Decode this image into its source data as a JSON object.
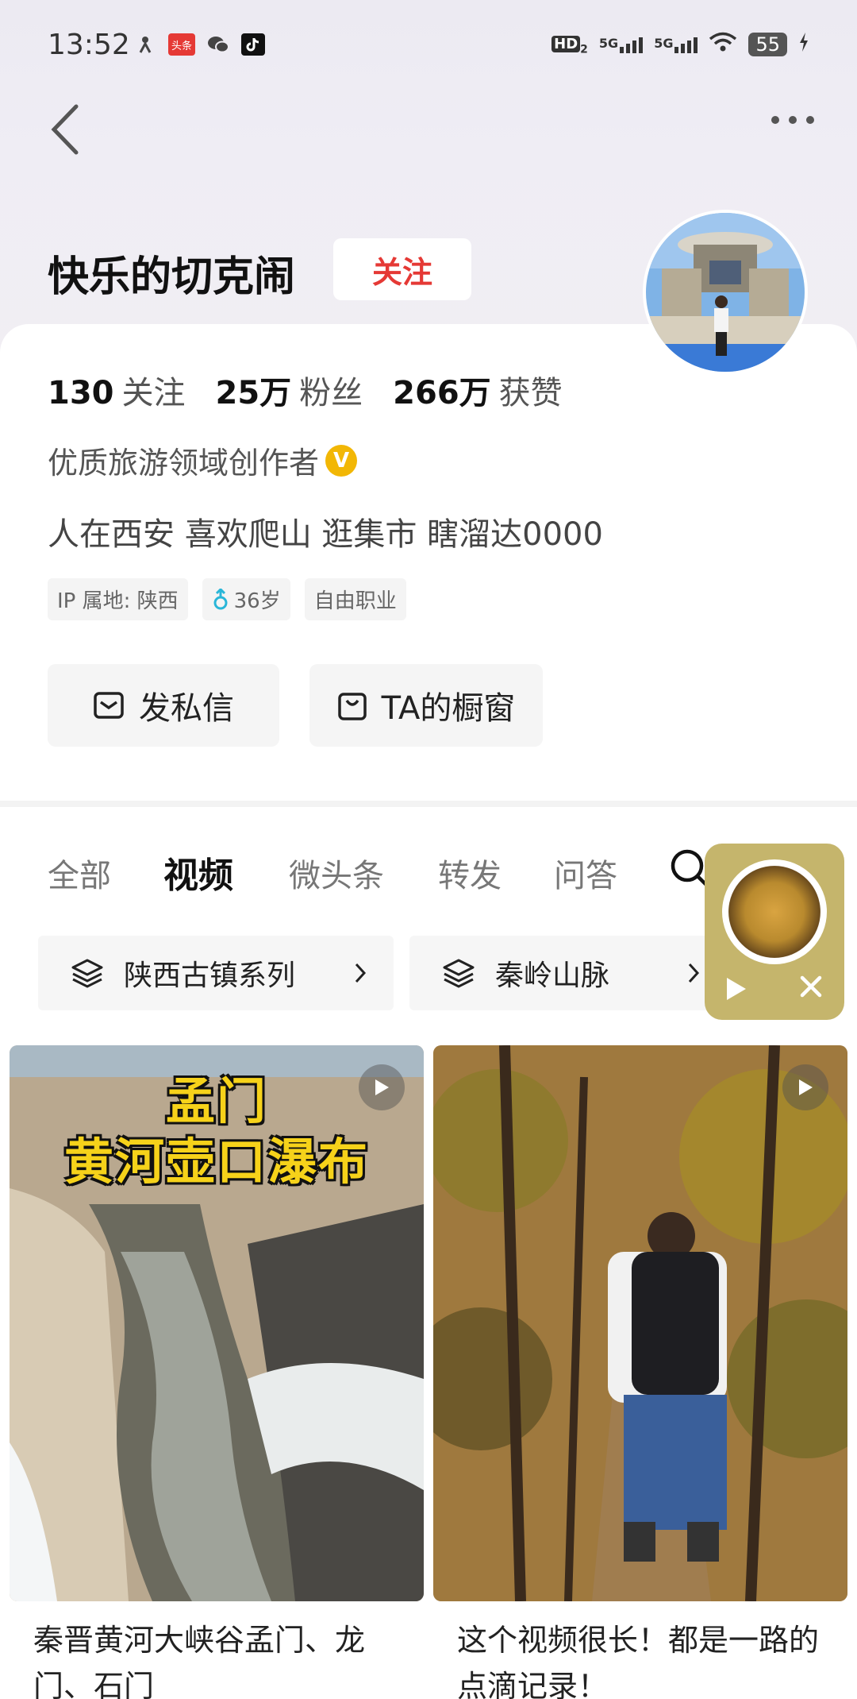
{
  "status_bar": {
    "time": "13:52",
    "app_icons": [
      "dance-icon",
      "toutiao-icon",
      "wechat-icon",
      "tiktok-icon"
    ],
    "toutiao_text": "头条",
    "hd": "HD",
    "hd_sub": "2",
    "net1": "5G",
    "net2": "5G",
    "battery": "55"
  },
  "profile": {
    "name": "快乐的切克闹",
    "follow_label": "关注",
    "stats": [
      {
        "num": "130",
        "label": "关注"
      },
      {
        "num": "25万",
        "label": "粉丝"
      },
      {
        "num": "266万",
        "label": "获赞"
      }
    ],
    "certification": "优质旅游领域创作者",
    "cert_badge": "V",
    "bio": "人在西安 喜欢爬山 逛集市 瞎溜达0000",
    "tags": [
      "IP 属地: 陕西",
      "36岁",
      "自由职业"
    ],
    "actions": {
      "message": "发私信",
      "shop": "TA的橱窗"
    }
  },
  "tabs": [
    "全部",
    "视频",
    "微头条",
    "转发",
    "问答"
  ],
  "active_tab": "视频",
  "collections": [
    "陕西古镇系列",
    "秦岭山脉"
  ],
  "videos": [
    {
      "overlay_line1": "孟门",
      "overlay_line2": "黄河壶口瀑布",
      "caption": "秦晋黄河大峡谷孟门、龙门、石门"
    },
    {
      "overlay_line1": "",
      "overlay_line2": "",
      "caption": "这个视频很长！都是一路的点滴记录！"
    }
  ],
  "colors": {
    "accent_red": "#e53935",
    "badge_gold": "#f2b705",
    "overlay_yellow": "#f6d21a",
    "player_bg": "#c5b56c"
  }
}
